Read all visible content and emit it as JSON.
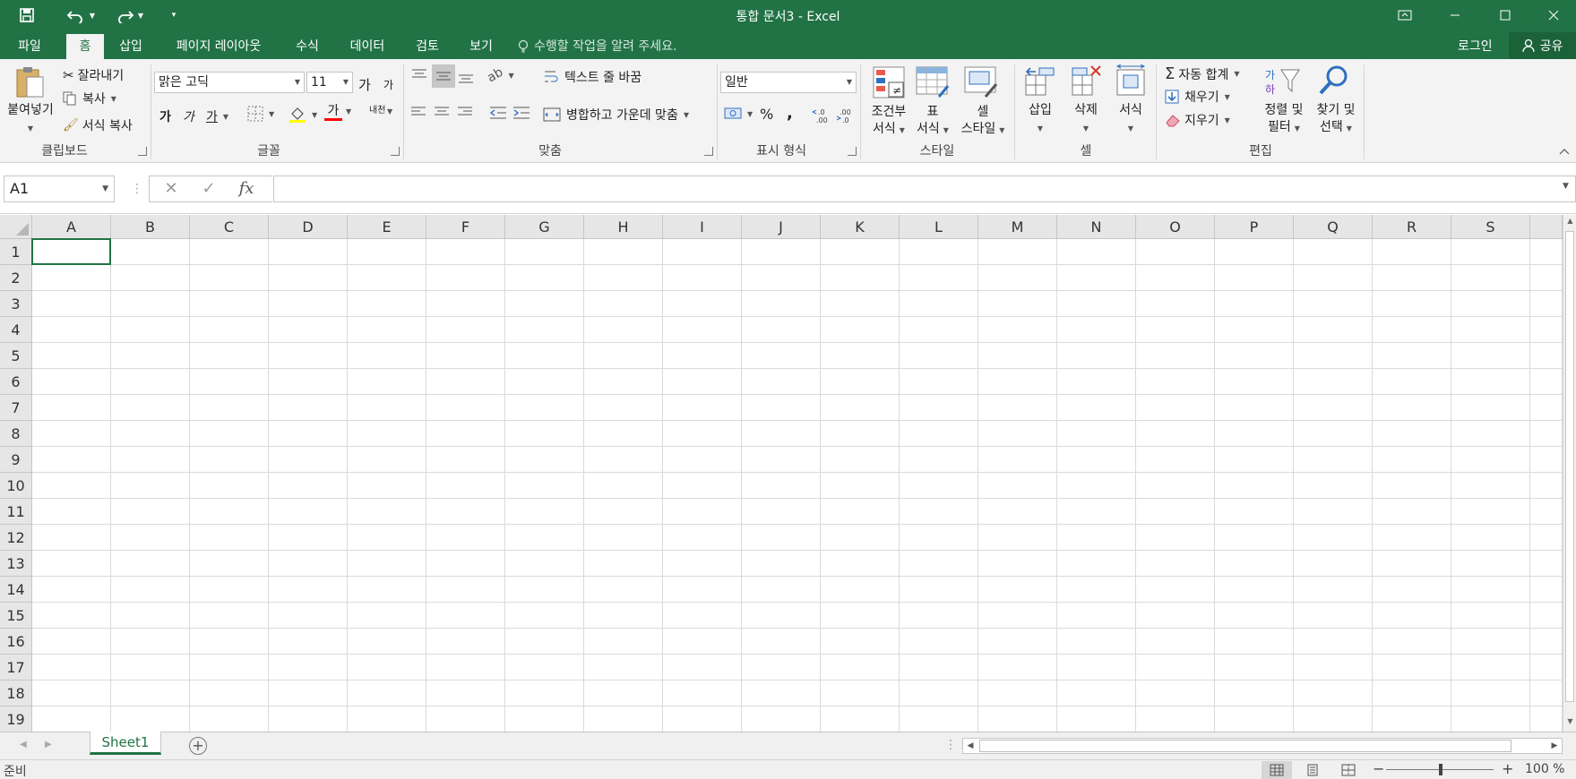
{
  "window": {
    "title": "통합 문서3 - Excel",
    "accent_color": "#217346",
    "quick_access": [
      "save-icon",
      "undo-icon",
      "redo-icon",
      "customize-icon"
    ]
  },
  "tabs": [
    {
      "label": "파일"
    },
    {
      "label": "홈",
      "active": true
    },
    {
      "label": "삽입"
    },
    {
      "label": "페이지 레이아웃"
    },
    {
      "label": "수식"
    },
    {
      "label": "데이터"
    },
    {
      "label": "검토"
    },
    {
      "label": "보기"
    }
  ],
  "tell_me": "수행할 작업을 알려 주세요.",
  "account": {
    "login": "로그인",
    "share": "공유"
  },
  "ribbon": {
    "clipboard": {
      "label": "클립보드",
      "paste": "붙여넣기",
      "cut": "잘라내기",
      "copy": "복사",
      "format_painter": "서식 복사"
    },
    "font": {
      "label": "글꼴",
      "font_name": "맑은 고딕",
      "font_size": "11",
      "grow": "가",
      "shrink": "가",
      "bold": "가",
      "italic": "가",
      "underline": "가",
      "font_color": "가",
      "phonetic": "내천"
    },
    "alignment": {
      "label": "맞춤",
      "wrap_text": "텍스트 줄 바꿈",
      "merge_center": "병합하고 가운데 맞춤"
    },
    "number": {
      "label": "표시 형식",
      "format": "일반",
      "percent": "%",
      "comma": ","
    },
    "styles": {
      "label": "스타일",
      "conditional_line1": "조건부",
      "conditional_line2": "서식",
      "table_line1": "표",
      "table_line2": "서식",
      "cell_style_line1": "셀",
      "cell_style_line2": "스타일"
    },
    "cells": {
      "label": "셀",
      "insert": "삽입",
      "delete": "삭제",
      "format": "서식"
    },
    "editing": {
      "label": "편집",
      "autosum": "자동 합계",
      "fill": "채우기",
      "clear": "지우기",
      "sort_line1": "정렬 및",
      "sort_line2": "필터",
      "find_line1": "찾기 및",
      "find_line2": "선택"
    }
  },
  "formula_bar": {
    "name_box": "A1",
    "fx": "fx",
    "value": ""
  },
  "sheet": {
    "columns": [
      "A",
      "B",
      "C",
      "D",
      "E",
      "F",
      "G",
      "H",
      "I",
      "J",
      "K",
      "L",
      "M",
      "N",
      "O",
      "P",
      "Q",
      "R",
      "S"
    ],
    "rows": [
      "1",
      "2",
      "3",
      "4",
      "5",
      "6",
      "7",
      "8",
      "9",
      "10",
      "11",
      "12",
      "13",
      "14",
      "15",
      "16",
      "17",
      "18",
      "19"
    ]
  },
  "sheet_tabs": [
    {
      "label": "Sheet1",
      "active": true
    }
  ],
  "status": {
    "text": "준비",
    "zoom": "100 %"
  }
}
